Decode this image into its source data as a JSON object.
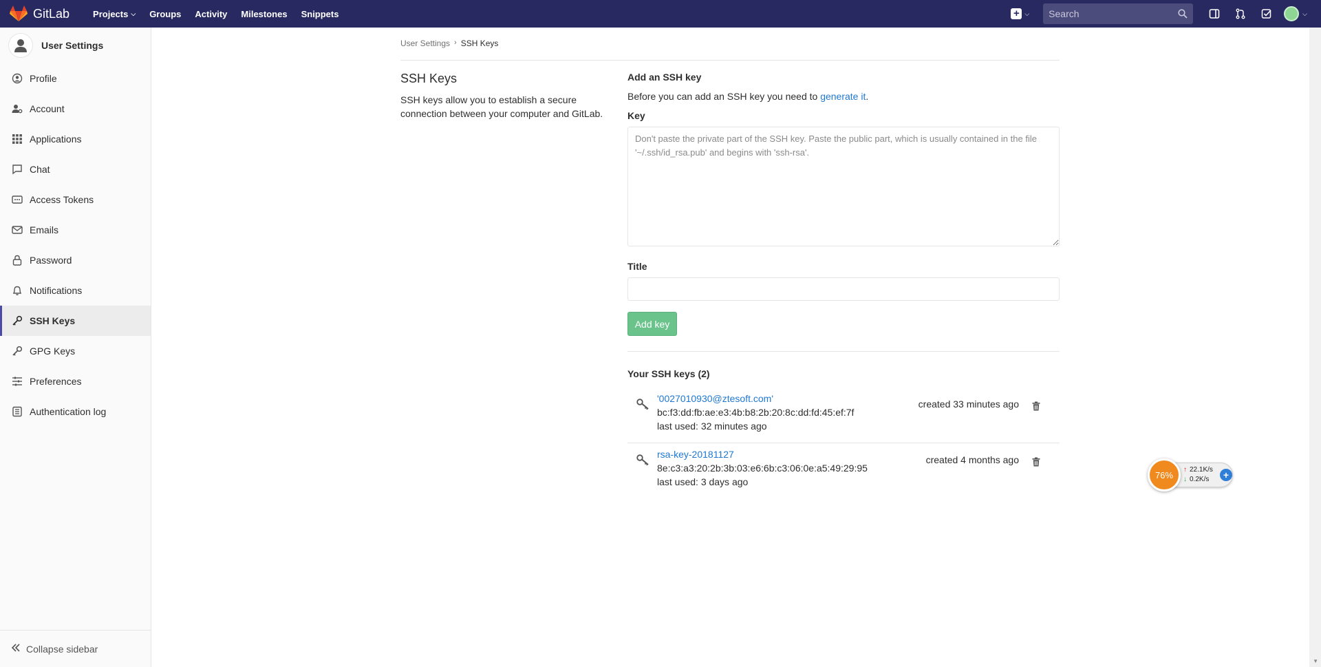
{
  "navbar": {
    "brand": "GitLab",
    "links": [
      {
        "label": "Projects",
        "has_dropdown": true
      },
      {
        "label": "Groups"
      },
      {
        "label": "Activity"
      },
      {
        "label": "Milestones"
      },
      {
        "label": "Snippets"
      }
    ],
    "search_placeholder": "Search",
    "background": "#292961"
  },
  "sidebar": {
    "title": "User Settings",
    "items": [
      {
        "label": "Profile",
        "icon": "profile-icon"
      },
      {
        "label": "Account",
        "icon": "account-icon"
      },
      {
        "label": "Applications",
        "icon": "applications-icon"
      },
      {
        "label": "Chat",
        "icon": "chat-icon"
      },
      {
        "label": "Access Tokens",
        "icon": "token-icon"
      },
      {
        "label": "Emails",
        "icon": "mail-icon"
      },
      {
        "label": "Password",
        "icon": "lock-icon"
      },
      {
        "label": "Notifications",
        "icon": "bell-icon"
      },
      {
        "label": "SSH Keys",
        "icon": "key-icon",
        "active": true
      },
      {
        "label": "GPG Keys",
        "icon": "key-icon"
      },
      {
        "label": "Preferences",
        "icon": "sliders-icon"
      },
      {
        "label": "Authentication log",
        "icon": "log-icon"
      }
    ],
    "collapse_label": "Collapse sidebar"
  },
  "breadcrumb": {
    "parent": "User Settings",
    "current": "SSH Keys"
  },
  "intro": {
    "heading": "SSH Keys",
    "description": "SSH keys allow you to establish a secure connection between your computer and GitLab."
  },
  "form": {
    "heading": "Add an SSH key",
    "prefix": "Before you can add an SSH key you need to ",
    "link": "generate it",
    "suffix": ".",
    "key_label": "Key",
    "key_placeholder": "Don't paste the private part of the SSH key. Paste the public part, which is usually contained in the file '~/.ssh/id_rsa.pub' and begins with 'ssh-rsa'.",
    "title_label": "Title",
    "title_value": "",
    "submit_label": "Add key",
    "submit_color": "#69c38b"
  },
  "keys": {
    "heading": "Your SSH keys (2)",
    "items": [
      {
        "title": "'0027010930@ztesoft.com'",
        "fingerprint": "bc:f3:dd:fb:ae:e3:4b:b8:2b:20:8c:dd:fd:45:ef:7f",
        "last_used": "last used: 32 minutes ago",
        "created": "created 33 minutes ago"
      },
      {
        "title": "rsa-key-20181127",
        "fingerprint": "8e:c3:a3:20:2b:3b:03:e6:6b:c3:06:0e:a5:49:29:95",
        "last_used": "last used: 3 days ago",
        "created": "created 4 months ago"
      }
    ]
  },
  "widget": {
    "percent": "76%",
    "up": "22.1K/s",
    "down": "0.2K/s"
  }
}
